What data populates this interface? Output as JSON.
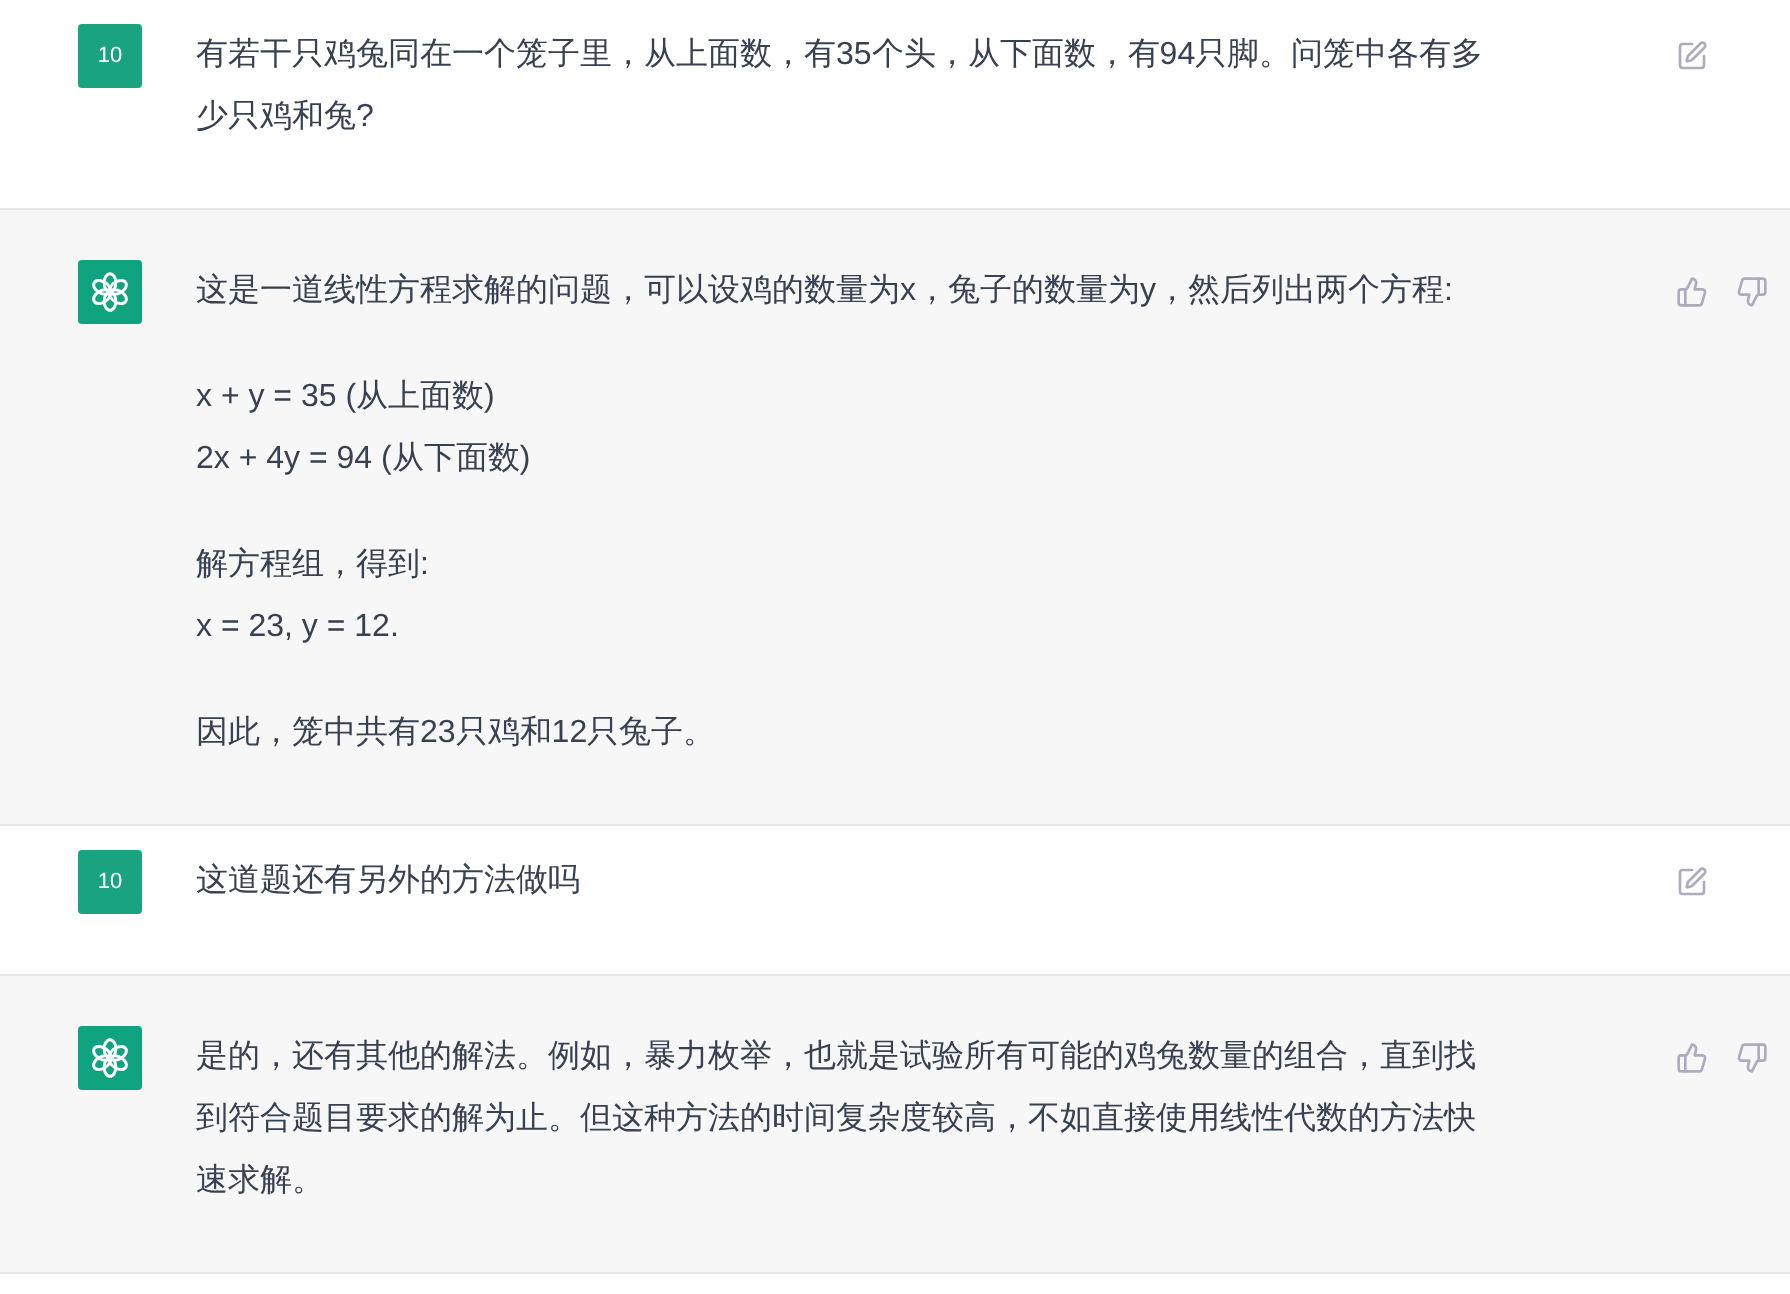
{
  "messages": [
    {
      "kind": "user",
      "avatar": "10",
      "paragraphs": [
        [
          "有若干只鸡兔同在一个笼子里，从上面数，有35个头，从下面数，有94只脚。问笼中各有多少只鸡和兔?"
        ]
      ]
    },
    {
      "kind": "assistant",
      "paragraphs": [
        [
          "这是一道线性方程求解的问题，可以设鸡的数量为x，兔子的数量为y，然后列出两个方程:"
        ],
        [
          "x + y = 35 (从上面数)",
          "2x + 4y = 94 (从下面数)"
        ],
        [
          "解方程组，得到:",
          "x = 23, y = 12."
        ],
        [
          "因此，笼中共有23只鸡和12只兔子。"
        ]
      ]
    },
    {
      "kind": "user",
      "avatar": "10",
      "paragraphs": [
        [
          "这道题还有另外的方法做吗"
        ]
      ]
    },
    {
      "kind": "assistant",
      "paragraphs": [
        [
          "是的，还有其他的解法。例如，暴力枚举，也就是试验所有可能的鸡兔数量的组合，直到找到符合题目要求的解为止。但这种方法的时间复杂度较高，不如直接使用线性代数的方法快速求解。"
        ]
      ]
    }
  ]
}
